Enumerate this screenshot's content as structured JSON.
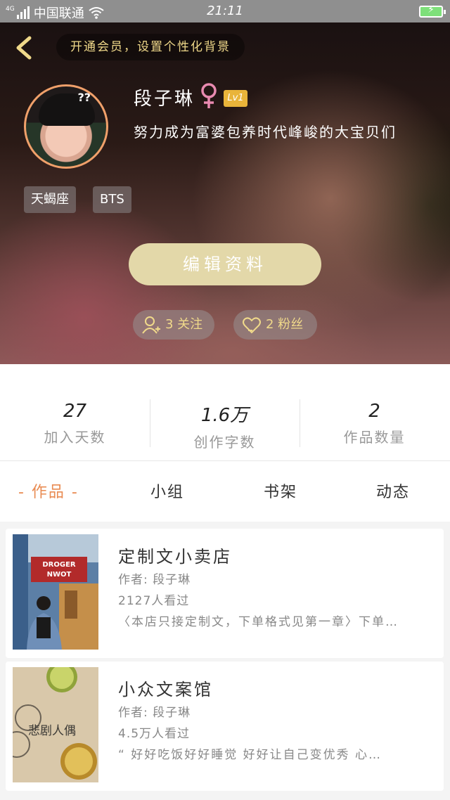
{
  "status_bar": {
    "network": "4G",
    "carrier": "中国联通",
    "time": "21:11",
    "icons": [
      "signal-icon",
      "wifi-icon",
      "battery-charging-icon"
    ]
  },
  "header": {
    "back_icon": "chevron-left-icon",
    "vip_banner": "开通会员，设置个性化背景"
  },
  "profile": {
    "username": "段子琳",
    "gender_icon": "female-symbol-icon",
    "level": "Lv1",
    "bio": "努力成为富婆包养时代峰峻的大宝贝们",
    "avatar_badge": "??",
    "tags": [
      "天蝎座",
      "BTS"
    ],
    "edit_button": "编辑资料",
    "following": "3 关注",
    "followers": "2 粉丝"
  },
  "stats": [
    {
      "value": "27",
      "label": "加入天数"
    },
    {
      "value": "1.6万",
      "label": "创作字数"
    },
    {
      "value": "2",
      "label": "作品数量"
    }
  ],
  "tabs": [
    {
      "label": "- 作品 -",
      "active": true
    },
    {
      "label": "小组",
      "active": false
    },
    {
      "label": "书架",
      "active": false
    },
    {
      "label": "动态",
      "active": false
    }
  ],
  "works": [
    {
      "title": "定制文小卖店",
      "author": "作者: 段子琳",
      "views": "2127人看过",
      "description": "〈本店只接定制文，下单格式见第一章〉下单…",
      "cover_text": [
        "DROGER",
        "NWOT"
      ]
    },
    {
      "title": "小众文案馆",
      "author": "作者: 段子琳",
      "views": "4.5万人看过",
      "description": "“ 好好吃饭好好睡觉 好好让自己变优秀 心…",
      "cover_text": [
        "悲剧人偶"
      ]
    }
  ],
  "colors": {
    "accent": "#e98b52",
    "gold": "#f0d98a",
    "edit_button": "#e3d8a9",
    "level_badge": "#e9b43a"
  }
}
